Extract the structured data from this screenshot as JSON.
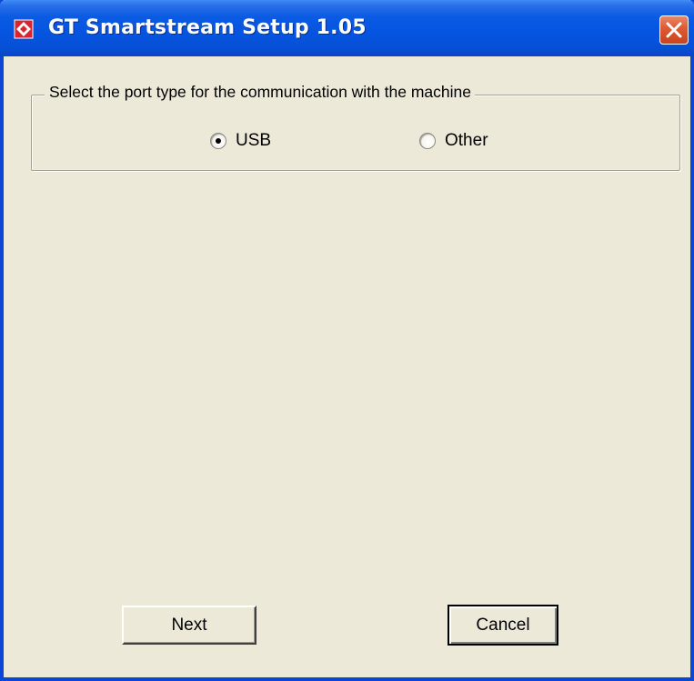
{
  "window": {
    "title": "GT Smartstream Setup 1.05",
    "icon": "app-diamond-icon",
    "close_icon": "close-icon"
  },
  "port_group": {
    "label": "Select the port type for the communication with the machine",
    "options": [
      {
        "label": "USB",
        "selected": true
      },
      {
        "label": "Other",
        "selected": false
      }
    ]
  },
  "buttons": {
    "next": "Next",
    "cancel": "Cancel"
  },
  "colors": {
    "titlebar": "#0554e0",
    "dialog_bg": "#ece9d8",
    "close_button": "#dd5c36",
    "icon_red": "#d9232e"
  }
}
